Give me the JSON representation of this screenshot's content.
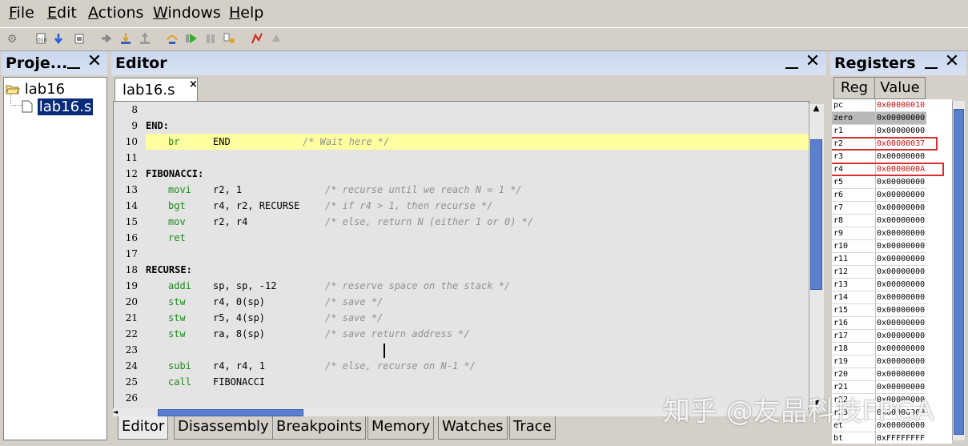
{
  "menu": {
    "file": {
      "u": "F",
      "rest": "ile"
    },
    "edit": {
      "u": "E",
      "rest": "dit"
    },
    "actions": {
      "u": "A",
      "rest": "ctions"
    },
    "windows": {
      "u": "W",
      "rest": "indows"
    },
    "help": {
      "u": "H",
      "rest": "elp"
    }
  },
  "toolbar": {
    "icons": [
      "gear-icon",
      "load-icon",
      "download-icon",
      "compile-load-icon",
      "continue-icon",
      "step-into-icon",
      "step-out-icon",
      "step-over-icon",
      "run-icon",
      "pause-icon",
      "restart-icon",
      "breakpoint-icon",
      "reset-icon"
    ]
  },
  "project": {
    "title": "Proje...",
    "folder": "lab16",
    "file": "lab16.s"
  },
  "editor": {
    "title": "Editor",
    "tab_label": "lab16.s",
    "tab_close": "×",
    "lines": [
      {
        "n": "8",
        "label": "",
        "op": "",
        "args": "",
        "comment": ""
      },
      {
        "n": "9",
        "label": "END:",
        "op": "",
        "args": "",
        "comment": ""
      },
      {
        "n": "10",
        "label": "",
        "op": "br",
        "args": "END",
        "comment": "/* Wait here */",
        "highlight": true
      },
      {
        "n": "11",
        "label": "",
        "op": "",
        "args": "",
        "comment": ""
      },
      {
        "n": "12",
        "label": "FIBONACCI:",
        "op": "",
        "args": "",
        "comment": ""
      },
      {
        "n": "13",
        "label": "",
        "op": "movi",
        "args": "r2, 1",
        "comment": "/* recurse until we reach N = 1 */"
      },
      {
        "n": "14",
        "label": "",
        "op": "bgt",
        "args": "r4, r2, RECURSE",
        "comment": "/* if r4 > 1, then recurse */"
      },
      {
        "n": "15",
        "label": "",
        "op": "mov",
        "args": "r2, r4",
        "comment": "/* else, return N (either 1 or 0) */"
      },
      {
        "n": "16",
        "label": "",
        "op": "ret",
        "args": "",
        "comment": ""
      },
      {
        "n": "17",
        "label": "",
        "op": "",
        "args": "",
        "comment": ""
      },
      {
        "n": "18",
        "label": "RECURSE:",
        "op": "",
        "args": "",
        "comment": ""
      },
      {
        "n": "19",
        "label": "",
        "op": "addi",
        "args": "sp, sp, -12",
        "comment": "/* reserve space on the stack */"
      },
      {
        "n": "20",
        "label": "",
        "op": "stw",
        "args": "r4, 0(sp)",
        "comment": "/* save */"
      },
      {
        "n": "21",
        "label": "",
        "op": "stw",
        "args": "r5, 4(sp)",
        "comment": "/* save */"
      },
      {
        "n": "22",
        "label": "",
        "op": "stw",
        "args": "ra, 8(sp)",
        "comment": "/* save return address */"
      },
      {
        "n": "23",
        "label": "",
        "op": "",
        "args": "",
        "comment": ""
      },
      {
        "n": "24",
        "label": "",
        "op": "subi",
        "args": "r4, r4, 1",
        "comment": "/* else, recurse on N-1 */"
      },
      {
        "n": "25",
        "label": "",
        "op": "call",
        "args": "FIBONACCI",
        "comment": ""
      },
      {
        "n": "26",
        "label": "",
        "op": "",
        "args": "",
        "comment": ""
      }
    ],
    "bottom_tabs": [
      "Editor",
      "Disassembly",
      "Breakpoints",
      "Memory",
      "Watches",
      "Trace"
    ]
  },
  "registers": {
    "title": "Registers",
    "col_reg": "Reg",
    "col_value": "Value",
    "rows": [
      {
        "reg": "pc",
        "value": "0x00000010",
        "changed": true
      },
      {
        "reg": "zero",
        "value": "0x00000000",
        "selected": true
      },
      {
        "reg": "r1",
        "value": "0x00000000"
      },
      {
        "reg": "r2",
        "value": "0x00000037",
        "changed": true,
        "boxed": true
      },
      {
        "reg": "r3",
        "value": "0x00000000"
      },
      {
        "reg": "r4",
        "value": "0x0000000A",
        "changed": true,
        "boxed": true
      },
      {
        "reg": "r5",
        "value": "0x00000000"
      },
      {
        "reg": "r6",
        "value": "0x00000000"
      },
      {
        "reg": "r7",
        "value": "0x00000000"
      },
      {
        "reg": "r8",
        "value": "0x00000000"
      },
      {
        "reg": "r9",
        "value": "0x00000000"
      },
      {
        "reg": "r10",
        "value": "0x00000000"
      },
      {
        "reg": "r11",
        "value": "0x00000000"
      },
      {
        "reg": "r12",
        "value": "0x00000000"
      },
      {
        "reg": "r13",
        "value": "0x00000000"
      },
      {
        "reg": "r14",
        "value": "0x00000000"
      },
      {
        "reg": "r15",
        "value": "0x00000000"
      },
      {
        "reg": "r16",
        "value": "0x00000000"
      },
      {
        "reg": "r17",
        "value": "0x00000000"
      },
      {
        "reg": "r18",
        "value": "0x00000000"
      },
      {
        "reg": "r19",
        "value": "0x00000000"
      },
      {
        "reg": "r20",
        "value": "0x00000000"
      },
      {
        "reg": "r21",
        "value": "0x00000000"
      },
      {
        "reg": "r22",
        "value": "0x00000000"
      },
      {
        "reg": "r23",
        "value": "0x00000000"
      },
      {
        "reg": "et",
        "value": "0x00000000"
      },
      {
        "reg": "bt",
        "value": "0xFFFFFFFF"
      }
    ]
  },
  "watermark": "知乎 @友晶科技FPGA"
}
